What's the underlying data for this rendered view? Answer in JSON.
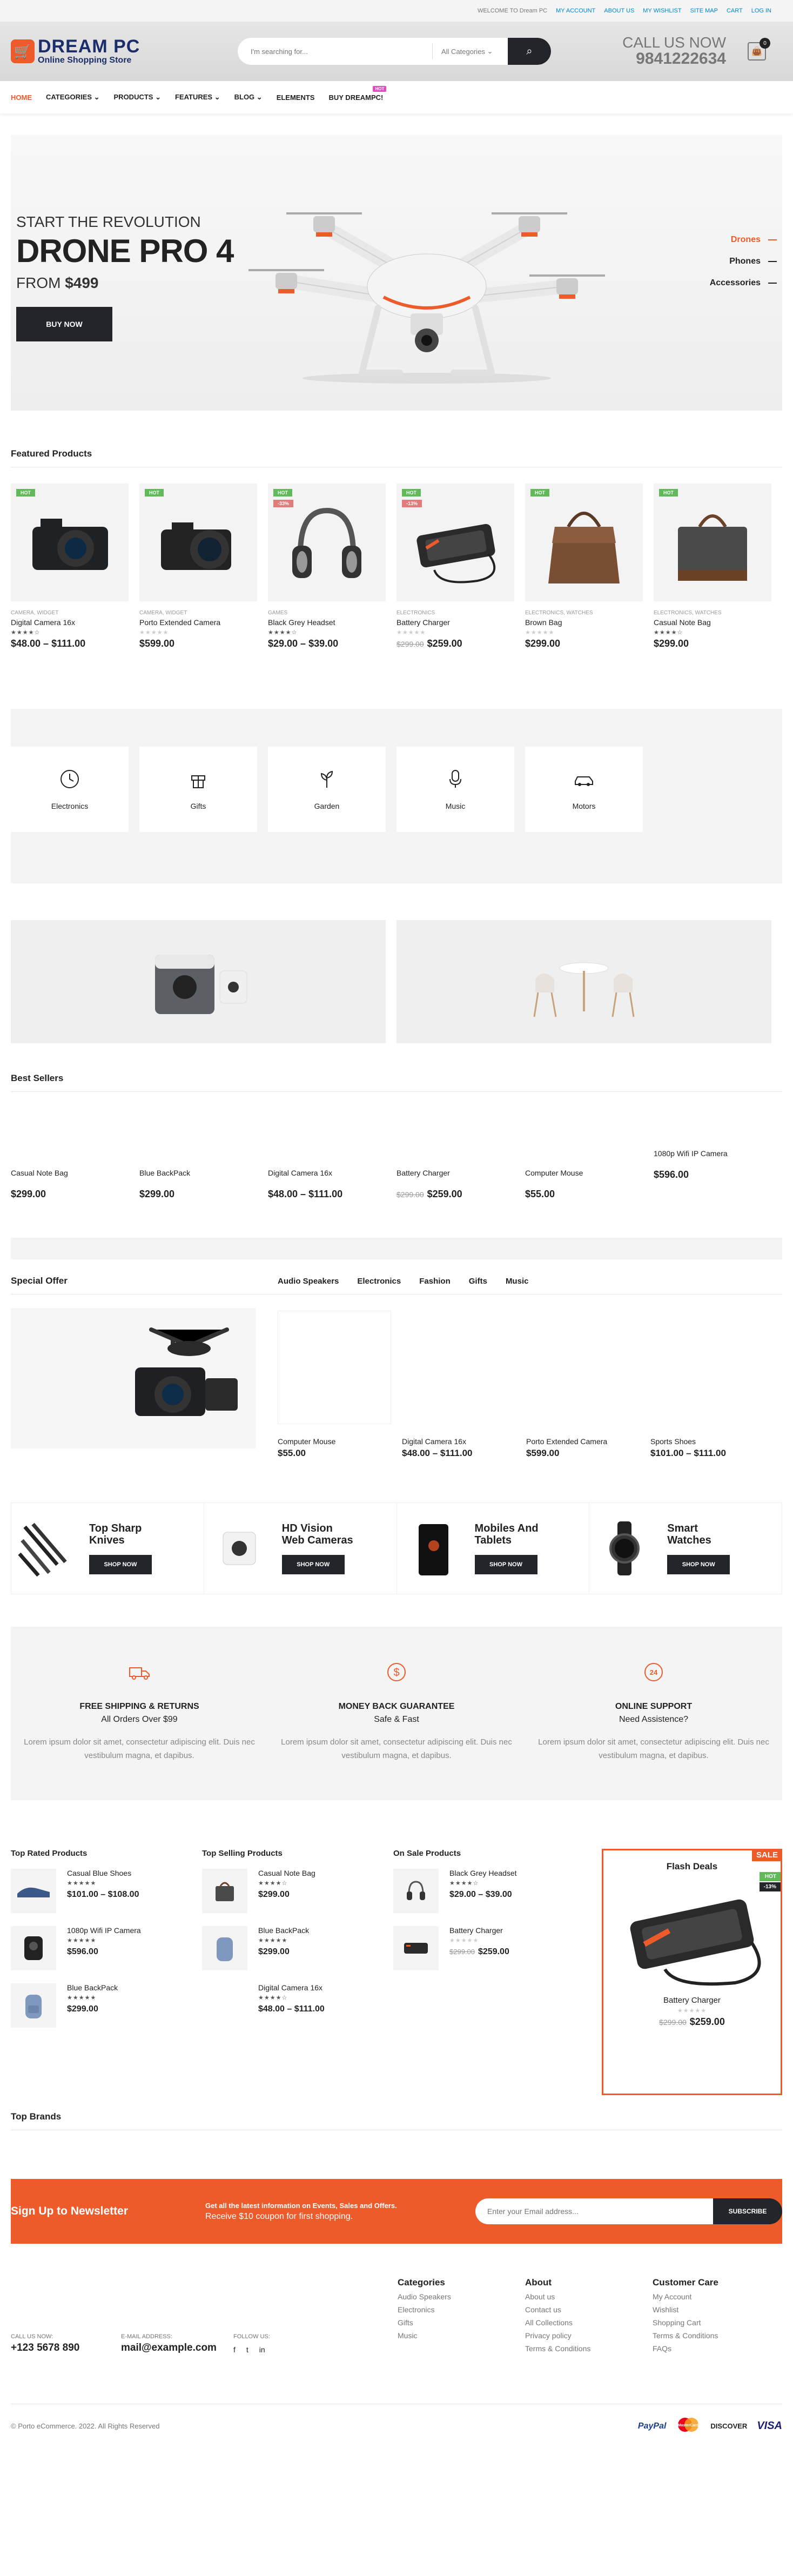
{
  "topbar": {
    "welcome": "WELCOME TO Dream PC",
    "links": [
      "MY ACCOUNT",
      "ABOUT US",
      "MY WISHLIST",
      "SITE MAP",
      "CART",
      "LOG IN"
    ]
  },
  "header": {
    "logo_title": "DREAM PC",
    "logo_sub": "Online Shopping Store",
    "search_placeholder": "I'm searching for...",
    "category_select": "All Categories",
    "call_label": "CALL US NOW",
    "phone": "9841222634",
    "cart_count": "0"
  },
  "nav": {
    "items": [
      "HOME",
      "CATEGORIES",
      "PRODUCTS",
      "FEATURES",
      "BLOG",
      "ELEMENTS",
      "BUY DREAMPC!"
    ],
    "hot_badge": "HOT"
  },
  "hero": {
    "subtitle": "START THE REVOLUTION",
    "title": "DRONE PRO 4",
    "price_prefix": "FROM",
    "price": "$499",
    "button": "BUY NOW",
    "categories": [
      "Drones",
      "Phones",
      "Accessories"
    ]
  },
  "featured": {
    "title": "Featured Products",
    "products": [
      {
        "cat": "CAMERA, WIDGET",
        "name": "Digital Camera 16x",
        "price": "$48.00 – $111.00",
        "old": "",
        "rated": true,
        "sale": ""
      },
      {
        "cat": "CAMERA, WIDGET",
        "name": "Porto Extended Camera",
        "price": "$599.00",
        "old": "",
        "rated": false,
        "sale": ""
      },
      {
        "cat": "GAMES",
        "name": "Black Grey Headset",
        "price": "$29.00 – $39.00",
        "old": "",
        "rated": true,
        "sale": "-33%"
      },
      {
        "cat": "ELECTRONICS",
        "name": "Battery Charger",
        "price": "$259.00",
        "old": "$299.00",
        "rated": false,
        "sale": "-13%"
      },
      {
        "cat": "ELECTRONICS, WATCHES",
        "name": "Brown Bag",
        "price": "$299.00",
        "old": "",
        "rated": false,
        "sale": ""
      },
      {
        "cat": "ELECTRONICS, WATCHES",
        "name": "Casual Note Bag",
        "price": "$299.00",
        "old": "",
        "rated": true,
        "sale": ""
      }
    ],
    "hot_label": "HOT"
  },
  "categories": [
    "Electronics",
    "Gifts",
    "Garden",
    "Music",
    "Motors"
  ],
  "best_sellers": {
    "title": "Best Sellers",
    "items": [
      {
        "name": "Casual Note Bag",
        "price": "$299.00",
        "old": ""
      },
      {
        "name": "Blue BackPack",
        "price": "$299.00",
        "old": ""
      },
      {
        "name": "Digital Camera 16x",
        "price": "$48.00 – $111.00",
        "old": ""
      },
      {
        "name": "Battery Charger",
        "price": "$259.00",
        "old": "$299.00"
      },
      {
        "name": "Computer Mouse",
        "price": "$55.00",
        "old": ""
      },
      {
        "name": "1080p Wifi IP Camera",
        "price": "$596.00",
        "old": ""
      }
    ]
  },
  "special": {
    "title": "Special Offer",
    "tabs": [
      "Audio Speakers",
      "Electronics",
      "Fashion",
      "Gifts",
      "Music"
    ],
    "items": [
      {
        "name": "Computer Mouse",
        "price": "$55.00"
      },
      {
        "name": "Digital Camera 16x",
        "price": "$48.00 – $111.00"
      },
      {
        "name": "Porto Extended Camera",
        "price": "$599.00"
      },
      {
        "name": "Sports Shoes",
        "price": "$101.00 – $111.00"
      }
    ]
  },
  "promos": [
    {
      "title": "Top Sharp Knives",
      "button": "SHOP NOW"
    },
    {
      "title": "HD Vision Web Cameras",
      "button": "SHOP NOW"
    },
    {
      "title": "Mobiles And Tablets",
      "button": "SHOP NOW"
    },
    {
      "title": "Smart Watches",
      "button": "SHOP NOW"
    }
  ],
  "features": [
    {
      "title": "FREE SHIPPING & RETURNS",
      "sub": "All Orders Over $99",
      "text": "Lorem ipsum dolor sit amet, consectetur adipiscing elit. Duis nec vestibulum magna, et dapibus."
    },
    {
      "title": "MONEY BACK GUARANTEE",
      "sub": "Safe & Fast",
      "text": "Lorem ipsum dolor sit amet, consectetur adipiscing elit. Duis nec vestibulum magna, et dapibus."
    },
    {
      "title": "ONLINE SUPPORT",
      "sub": "Need Assistence?",
      "text": "Lorem ipsum dolor sit amet, consectetur adipiscing elit. Duis nec vestibulum magna, et dapibus."
    }
  ],
  "lists": [
    {
      "title": "Top Rated Products",
      "items": [
        {
          "name": "Casual Blue Shoes",
          "price": "$101.00 – $108.00",
          "old": ""
        },
        {
          "name": "1080p Wifi IP Camera",
          "price": "$596.00",
          "old": ""
        },
        {
          "name": "Blue BackPack",
          "price": "$299.00",
          "old": ""
        }
      ]
    },
    {
      "title": "Top Selling Products",
      "items": [
        {
          "name": "Casual Note Bag",
          "price": "$299.00",
          "old": ""
        },
        {
          "name": "Blue BackPack",
          "price": "$299.00",
          "old": ""
        },
        {
          "name": "Digital Camera 16x",
          "price": "$48.00 – $111.00",
          "old": ""
        }
      ]
    },
    {
      "title": "On Sale Products",
      "items": [
        {
          "name": "Black Grey Headset",
          "price": "$29.00 – $39.00",
          "old": ""
        },
        {
          "name": "Battery Charger",
          "price": "$259.00",
          "old": "$299.00"
        }
      ]
    }
  ],
  "flash": {
    "title": "Flash Deals",
    "ribbon": "SALE",
    "hot": "HOT",
    "discount": "-13%",
    "name": "Battery Charger",
    "old": "$299.00",
    "price": "$259.00"
  },
  "brands_title": "Top Brands",
  "newsletter": {
    "title": "Sign Up to Newsletter",
    "line1": "Get all the latest information on Events, Sales and Offers.",
    "line2": "Receive $10 coupon for first shopping.",
    "placeholder": "Enter your Email address...",
    "button": "SUBSCRIBE"
  },
  "footer": {
    "cols": [
      {
        "title": "Categories",
        "links": [
          "Audio Speakers",
          "Electronics",
          "Gifts",
          "Music"
        ]
      },
      {
        "title": "About",
        "links": [
          "About us",
          "Contact us",
          "All Collections",
          "Privacy policy",
          "Terms & Conditions"
        ]
      },
      {
        "title": "Customer Care",
        "links": [
          "My Account",
          "Wishlist",
          "Shopping Cart",
          "Terms & Conditions",
          "FAQs"
        ]
      }
    ],
    "call_label": "CALL US NOW:",
    "phone": "+123 5678 890",
    "email_label": "E-MAIL ADDRESS:",
    "email": "mail@example.com",
    "follow_label": "FOLLOW US:",
    "copyright": "© Porto eCommerce. 2022. All Rights Reserved",
    "payments": [
      "PayPal",
      "MasterCard",
      "DISCOVER",
      "VISA"
    ]
  },
  "colors": {
    "accent": "#ee5b2b",
    "dark": "#222529",
    "hot": "#62b959",
    "sale": "#e27c7c"
  }
}
